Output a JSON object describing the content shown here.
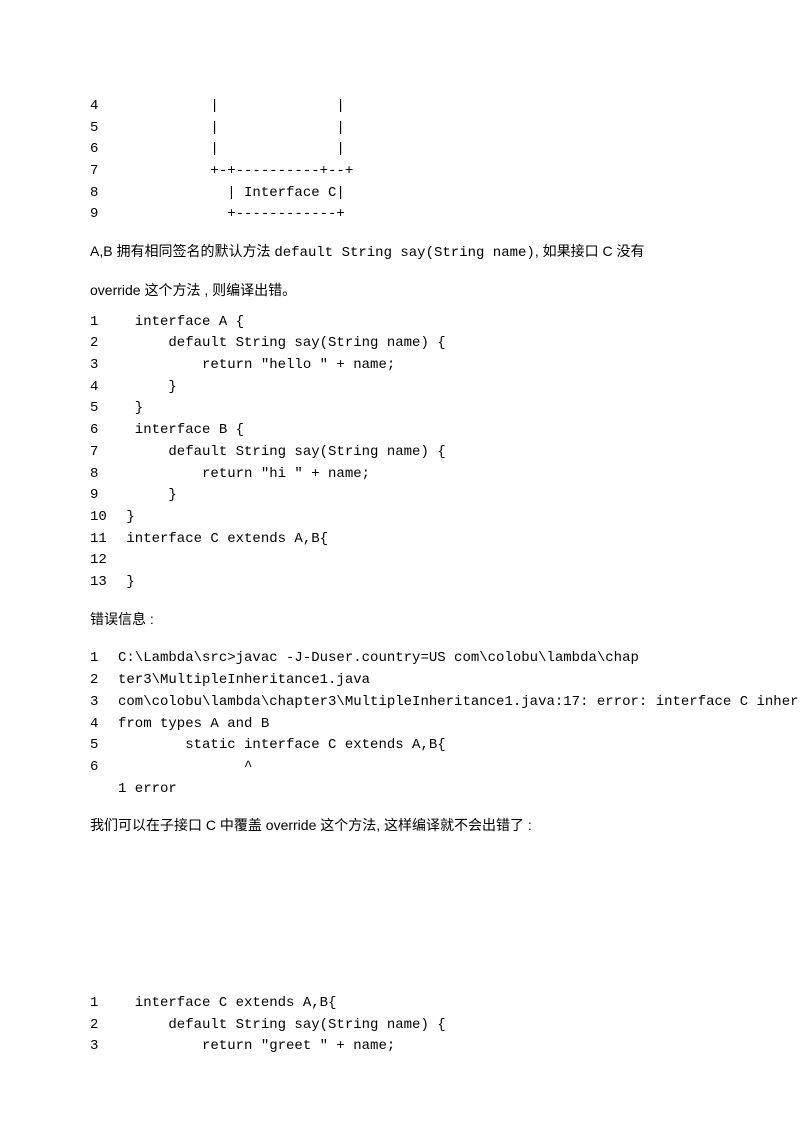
{
  "block1": {
    "lines": [
      {
        "n": "4",
        "c": "           |              |"
      },
      {
        "n": "5",
        "c": "           |              |"
      },
      {
        "n": "6",
        "c": "           |              |"
      },
      {
        "n": "7",
        "c": "           +-+----------+--+"
      },
      {
        "n": "8",
        "c": "             | Interface C|"
      },
      {
        "n": "9",
        "c": "             +------------+"
      }
    ]
  },
  "para1_pre": "A,B 拥有相同签名的默认方法 ",
  "para1_code": "default String say(String name)",
  "para1_post": ",  如果接口 C 没有",
  "para2": "override 这个方法 ,   则编译出错。",
  "block2": {
    "lines": [
      {
        "n": "1",
        "c": "  interface A {"
      },
      {
        "n": "2",
        "c": "      default String say(String name) {"
      },
      {
        "n": "3",
        "c": "          return \"hello \" + name;"
      },
      {
        "n": "4",
        "c": "      }"
      },
      {
        "n": "5",
        "c": "  }"
      },
      {
        "n": "6",
        "c": "  interface B {"
      },
      {
        "n": "7",
        "c": "      default String say(String name) {"
      },
      {
        "n": "8",
        "c": "          return \"hi \" + name;"
      },
      {
        "n": "9",
        "c": "      }"
      },
      {
        "n": "10",
        "c": " }"
      },
      {
        "n": "11",
        "c": " interface C extends A,B{"
      },
      {
        "n": "12",
        "c": ""
      },
      {
        "n": "13",
        "c": " }"
      }
    ]
  },
  "para3": "错误信息 :",
  "block3": {
    "lines": [
      {
        "n": "1",
        "c": "C:\\Lambda\\src>javac -J-Duser.country=US com\\colobu\\lambda\\chap"
      },
      {
        "n": "2",
        "c": "ter3\\MultipleInheritance1.java"
      },
      {
        "n": "3",
        "c": "com\\colobu\\lambda\\chapter3\\MultipleInheritance1.java:17: error: interface C inher"
      },
      {
        "n": "4",
        "c": "from types A and B"
      },
      {
        "n": "5",
        "c": "        static interface C extends A,B{"
      },
      {
        "n": "6",
        "c": "               ^"
      },
      {
        "n": "",
        "c": "1 error"
      }
    ]
  },
  "para4": "我们可以在子接口 C 中覆盖 override 这个方法,  这样编译就不会出错了 :",
  "block4": {
    "lines": [
      {
        "n": "1",
        "c": "  interface C extends A,B{"
      },
      {
        "n": "2",
        "c": "      default String say(String name) {"
      },
      {
        "n": "3",
        "c": "          return \"greet \" + name;"
      }
    ]
  }
}
